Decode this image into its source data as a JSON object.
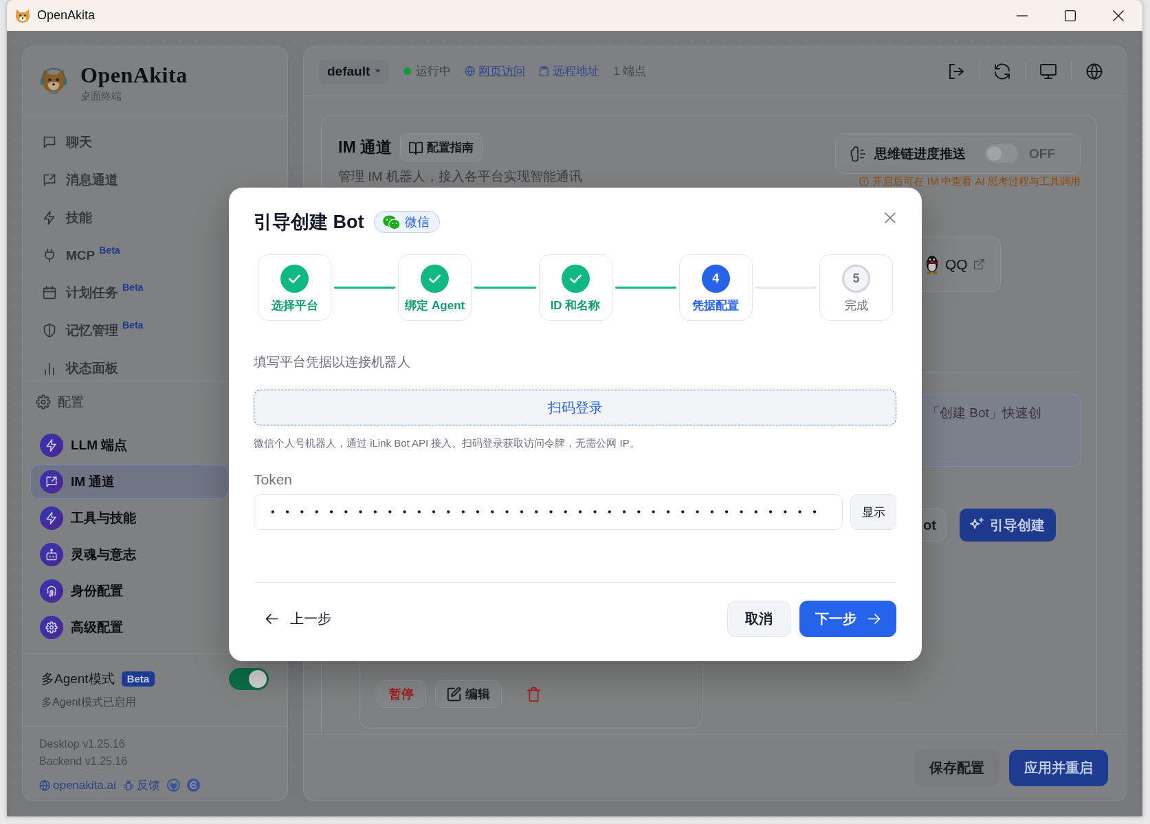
{
  "window": {
    "title": "OpenAkita"
  },
  "sidebar": {
    "brand": {
      "name": "OpenAkita",
      "subtitle": "桌面终端"
    },
    "nav_items": [
      {
        "label": "聊天"
      },
      {
        "label": "消息通道"
      },
      {
        "label": "技能"
      },
      {
        "label": "MCP",
        "badge": "Beta"
      },
      {
        "label": "计划任务",
        "badge": "Beta"
      },
      {
        "label": "记忆管理",
        "badge": "Beta"
      },
      {
        "label": "状态面板"
      }
    ],
    "config": {
      "title": "配置",
      "items": [
        {
          "label": "LLM 端点",
          "selected": false
        },
        {
          "label": "IM 通道",
          "selected": true
        },
        {
          "label": "工具与技能",
          "selected": false
        },
        {
          "label": "灵魂与意志",
          "selected": false
        },
        {
          "label": "身份配置",
          "selected": false
        },
        {
          "label": "高级配置",
          "selected": false
        }
      ]
    },
    "multi_agent": {
      "label": "多Agent模式",
      "badge": "Beta",
      "on": true,
      "status": "多Agent模式已启用"
    },
    "versions": [
      "Desktop v1.25.16",
      "Backend v1.25.16"
    ],
    "links": [
      "openakita.ai",
      "反馈"
    ]
  },
  "topbar": {
    "workspace": "default",
    "running": true,
    "status": "运行中",
    "web_access": "网页访问",
    "remote_address": "远程地址",
    "endpoints": "1 端点"
  },
  "page": {
    "title": "IM 通道",
    "guide_button": "配置指南",
    "description": "管理 IM 机器人，接入各平台实现智能通讯",
    "thinking_push": {
      "label": "思维链进度推送",
      "on": false,
      "state_text": "OFF",
      "hint": "开启后可在 IM 中查看 AI 思考过程与工具调用"
    },
    "platform_card": {
      "label": "QQ"
    },
    "info_text": "「创建 Bot」快速创",
    "actions": [
      {
        "label": "ot",
        "kind": "secondary"
      },
      {
        "label": "引导创建",
        "kind": "primary"
      }
    ],
    "bot_buttons": [
      {
        "label": "暂停",
        "kind": "danger"
      },
      {
        "label": "编辑",
        "kind": "edit"
      }
    ]
  },
  "footer": {
    "buttons": [
      {
        "label": "保存配置",
        "kind": "secondary"
      },
      {
        "label": "应用并重启",
        "kind": "primary"
      }
    ]
  },
  "dialog": {
    "title": "引导创建 Bot",
    "platform": "微信",
    "steps": [
      {
        "label": "选择平台",
        "completed": true,
        "current": false
      },
      {
        "label": "绑定 Agent",
        "completed": true,
        "current": false
      },
      {
        "label": "ID 和名称",
        "completed": true,
        "current": false
      },
      {
        "number": "4",
        "label": "凭据配置",
        "completed": false,
        "current": true
      },
      {
        "number": "5",
        "label": "完成",
        "completed": false,
        "current": false
      }
    ],
    "instruction": "填写平台凭据以连接机器人",
    "scan_button": "扫码登录",
    "note": "微信个人号机器人，通过 iLink Bot API 接入。扫码登录获取访问令牌，无需公网 IP。",
    "token": {
      "label": "Token",
      "value": "••••••••••••••••••••••••••••••••••••••"
    },
    "show_button": "显示",
    "back_button": "上一步",
    "cancel_button": "取消",
    "next_button": "下一步"
  }
}
